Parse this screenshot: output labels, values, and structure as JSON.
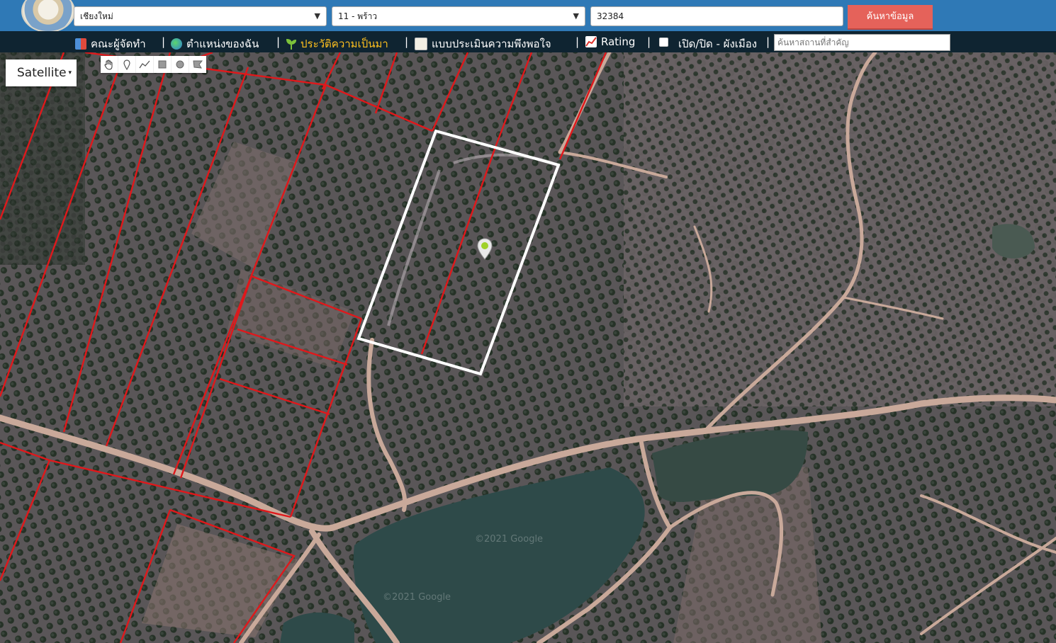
{
  "header": {
    "province_select": "เชียงใหม่",
    "district_select": "11 - พร้าว",
    "parcel_input": "32384",
    "search_button": "ค้นหาข้อมูล"
  },
  "menu": {
    "items": [
      {
        "label": "คณะผู้จัดทำ",
        "icon": "book-icon"
      },
      {
        "label": "ตำแหน่งของฉัน",
        "icon": "globe-icon"
      },
      {
        "label": "ประวัติความเป็นมา",
        "icon": "sprout-icon"
      },
      {
        "label": "แบบประเมินความพึงพอใจ",
        "icon": "memo-icon"
      },
      {
        "label": "Rating",
        "icon": "chart-icon"
      },
      {
        "label": "เปิด/ปิด - ผังเมือง",
        "icon": "checkbox"
      }
    ],
    "separator": "|",
    "place_search_placeholder": "ค้นหาสถานที่สำคัญ"
  },
  "map": {
    "layer_button": "Satellite",
    "tools": [
      "hand-icon",
      "marker-icon",
      "polyline-icon",
      "rectangle-icon",
      "circle-icon",
      "polygon-icon"
    ],
    "watermark_1": "©2021 Google",
    "watermark_2": "©2021 Google",
    "colors": {
      "parcel_outline": "#e0181b",
      "selected_parcel": "#ffffff",
      "marker": "#9fd12a"
    }
  }
}
